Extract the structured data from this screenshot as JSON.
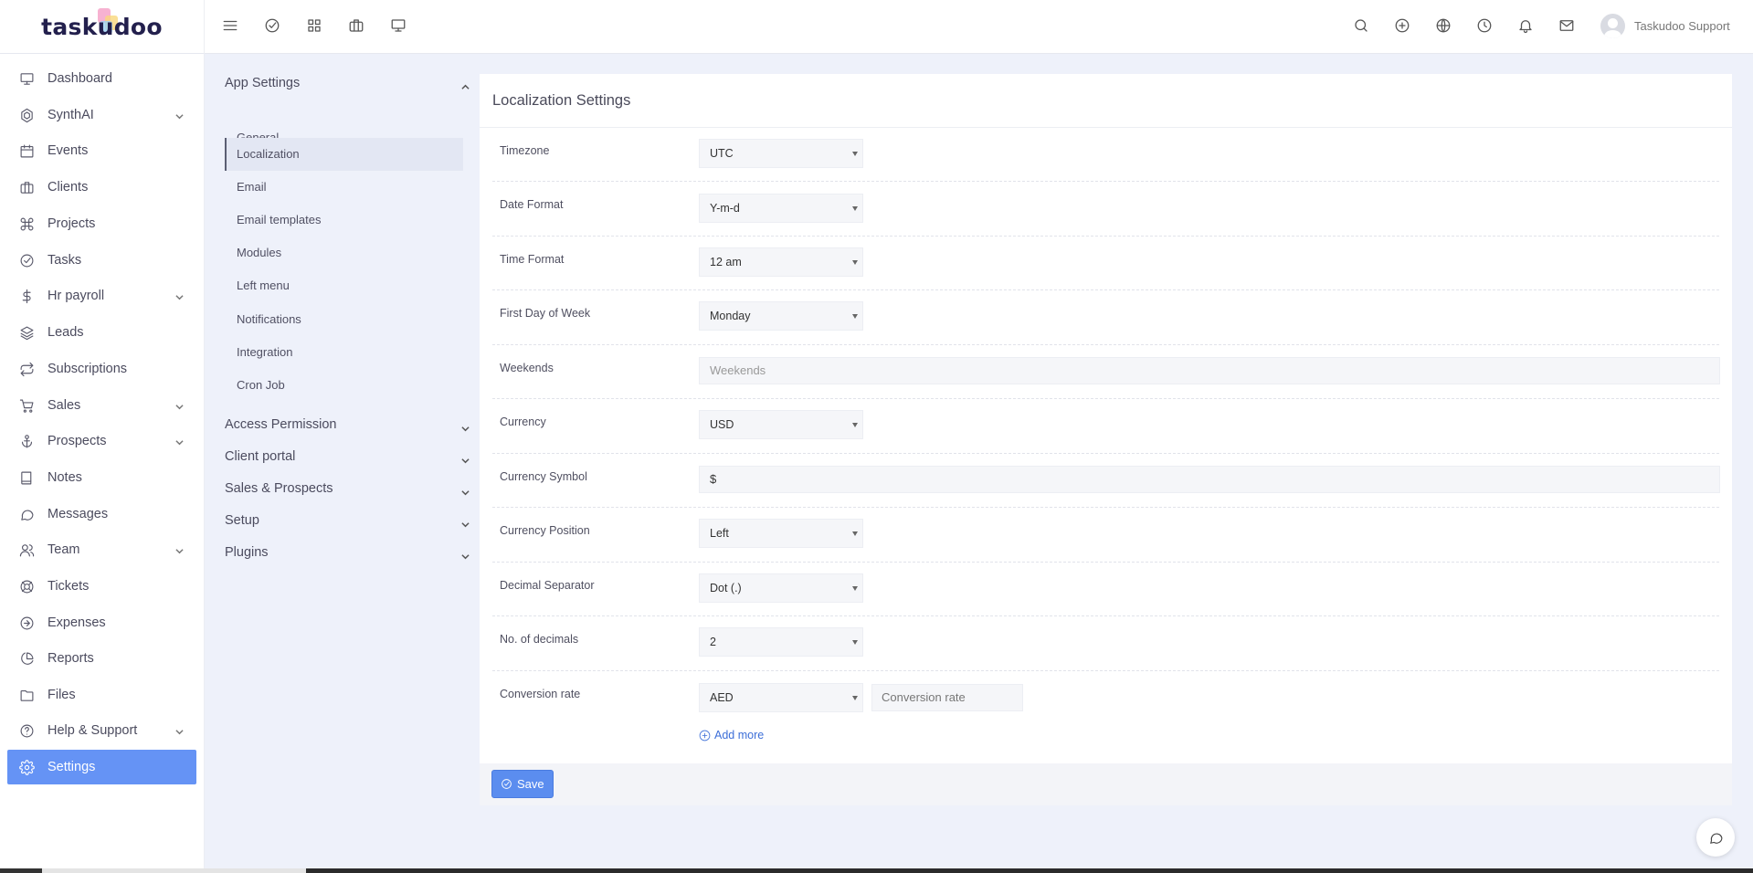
{
  "app": {
    "logo_text": "taskudoo",
    "user_name": "Taskudoo Support"
  },
  "topbar": {
    "left_icons": [
      "menu-icon",
      "check-circle-icon",
      "grid-icon",
      "briefcase-icon",
      "monitor-icon"
    ],
    "right_icons": [
      "search-icon",
      "plus-circle-icon",
      "globe-icon",
      "clock-icon",
      "bell-icon",
      "mail-icon"
    ]
  },
  "sidebar": {
    "items": [
      {
        "label": "Dashboard",
        "icon": "monitor-icon",
        "has_children": false
      },
      {
        "label": "SynthAI",
        "icon": "ai-icon",
        "has_children": true
      },
      {
        "label": "Events",
        "icon": "calendar-icon",
        "has_children": false
      },
      {
        "label": "Clients",
        "icon": "briefcase-icon",
        "has_children": false
      },
      {
        "label": "Projects",
        "icon": "command-icon",
        "has_children": false
      },
      {
        "label": "Tasks",
        "icon": "check-circle-icon",
        "has_children": false
      },
      {
        "label": "Hr payroll",
        "icon": "dollar-icon",
        "has_children": true
      },
      {
        "label": "Leads",
        "icon": "layers-icon",
        "has_children": false
      },
      {
        "label": "Subscriptions",
        "icon": "repeat-icon",
        "has_children": false
      },
      {
        "label": "Sales",
        "icon": "cart-icon",
        "has_children": true
      },
      {
        "label": "Prospects",
        "icon": "anchor-icon",
        "has_children": true
      },
      {
        "label": "Notes",
        "icon": "book-icon",
        "has_children": false
      },
      {
        "label": "Messages",
        "icon": "message-icon",
        "has_children": false
      },
      {
        "label": "Team",
        "icon": "users-icon",
        "has_children": true
      },
      {
        "label": "Tickets",
        "icon": "lifebuoy-icon",
        "has_children": false
      },
      {
        "label": "Expenses",
        "icon": "arrow-circle-icon",
        "has_children": false
      },
      {
        "label": "Reports",
        "icon": "pie-chart-icon",
        "has_children": false
      },
      {
        "label": "Files",
        "icon": "folder-icon",
        "has_children": false
      },
      {
        "label": "Help & Support",
        "icon": "help-circle-icon",
        "has_children": true
      },
      {
        "label": "Settings",
        "icon": "gear-icon",
        "has_children": false,
        "active": true
      }
    ]
  },
  "settings_menu": {
    "app_settings": {
      "label": "App Settings",
      "items": [
        "General",
        "Localization",
        "Email",
        "Email templates",
        "Modules",
        "Left menu",
        "Notifications",
        "Integration",
        "Cron Job"
      ],
      "active": "Localization"
    },
    "sections": [
      "Access Permission",
      "Client portal",
      "Sales & Prospects",
      "Setup",
      "Plugins"
    ]
  },
  "form": {
    "title": "Localization Settings",
    "timezone": {
      "label": "Timezone",
      "value": "UTC"
    },
    "date_format": {
      "label": "Date Format",
      "value": "Y-m-d"
    },
    "time_format": {
      "label": "Time Format",
      "value": "12 am"
    },
    "first_day": {
      "label": "First Day of Week",
      "value": "Monday"
    },
    "weekends": {
      "label": "Weekends",
      "placeholder": "Weekends"
    },
    "currency": {
      "label": "Currency",
      "value": "USD"
    },
    "currency_symbol": {
      "label": "Currency Symbol",
      "value": "$"
    },
    "currency_position": {
      "label": "Currency Position",
      "value": "Left"
    },
    "decimal_separator": {
      "label": "Decimal Separator",
      "value": "Dot (.)"
    },
    "decimals": {
      "label": "No. of decimals",
      "value": "2"
    },
    "conversion": {
      "label": "Conversion rate",
      "currency_value": "AED",
      "rate_placeholder": "Conversion rate",
      "add_more": "Add more"
    },
    "save_label": "Save"
  },
  "colors": {
    "accent": "#6593f5",
    "save_button": "#5b8def",
    "link": "#3d6fd8",
    "background": "#eef1fa"
  }
}
